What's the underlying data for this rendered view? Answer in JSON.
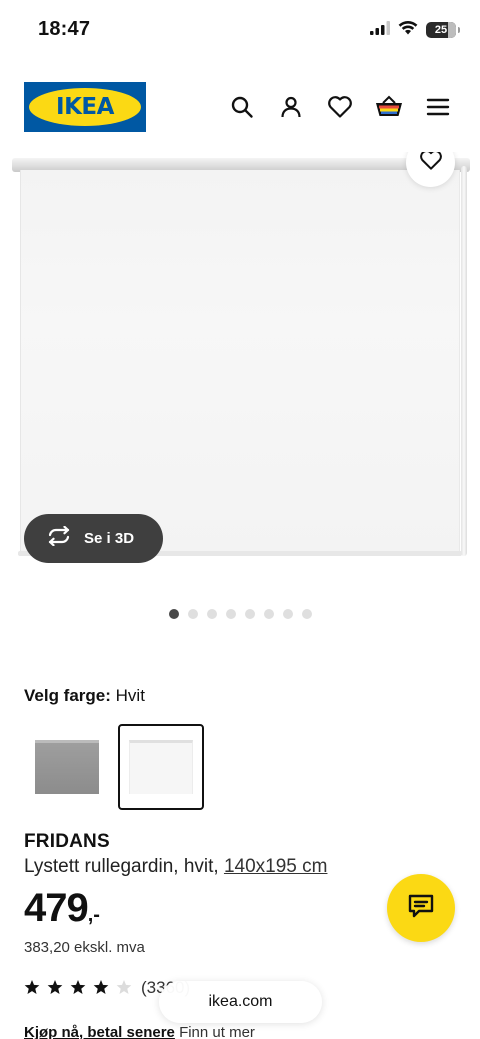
{
  "status_bar": {
    "time": "18:47",
    "battery": "25",
    "icons": [
      "cellular-signal-icon",
      "wifi-icon",
      "battery-icon"
    ]
  },
  "header": {
    "logo_text": "IKEA",
    "icons": [
      "search-icon",
      "account-icon",
      "favourites-icon",
      "cart-icon",
      "menu-icon"
    ]
  },
  "gallery": {
    "view_3d_label": "Se i 3D",
    "dot_count": 8,
    "active_dot": 0
  },
  "color_selector": {
    "label": "Velg farge:",
    "selected_value": "Hvit",
    "swatches": [
      {
        "name": "Grå",
        "selected": false
      },
      {
        "name": "Hvit",
        "selected": true
      }
    ]
  },
  "product": {
    "name": "FRIDANS",
    "description": "Lystett rullegardin, hvit,",
    "size_link": "140x195 cm",
    "price": "479",
    "price_suffix": ",-",
    "price_ex_vat": "383,20 ekskl. mva",
    "rating_stars": 4,
    "rating_max": 5,
    "review_count": "(3360)"
  },
  "buy_now": {
    "bold_text": "Kjøp nå, betal senere",
    "link_text": "Finn ut mer"
  },
  "browser": {
    "url": "ikea.com"
  },
  "colors": {
    "ikea_blue": "#0058a3",
    "ikea_yellow": "#fbd914",
    "text": "#111111"
  }
}
